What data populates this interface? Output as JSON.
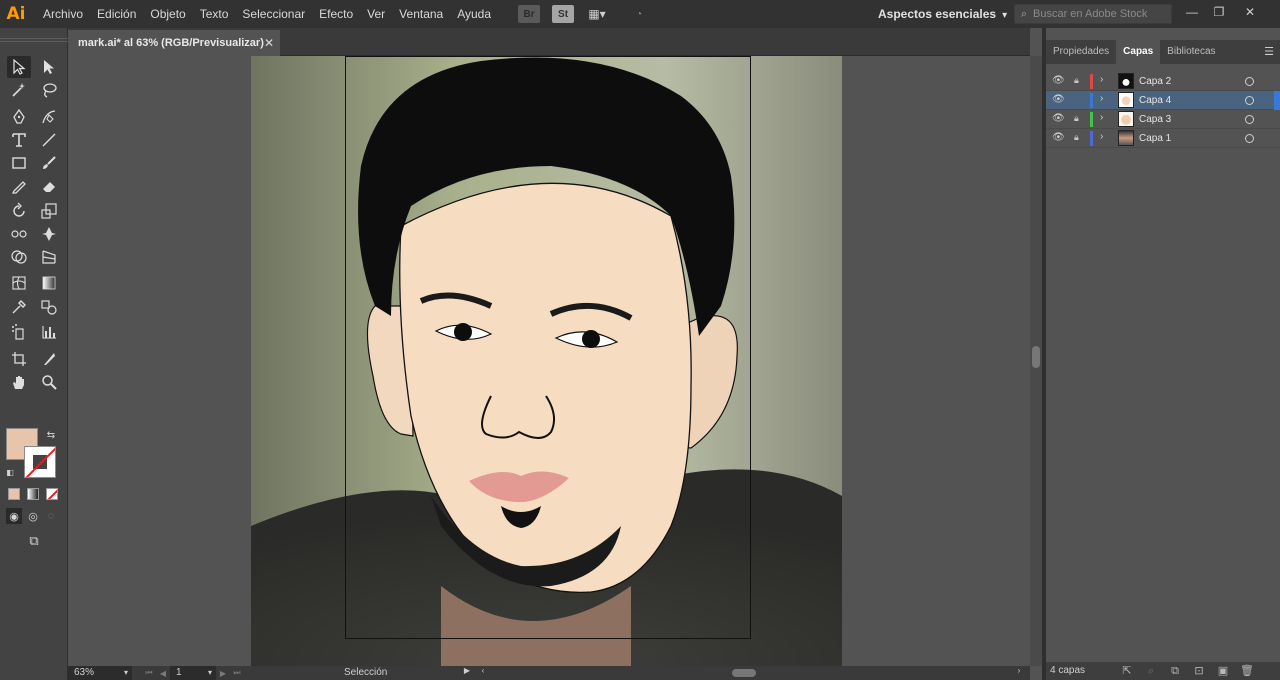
{
  "app": {
    "logo": "Ai"
  },
  "menu": [
    "Archivo",
    "Edición",
    "Objeto",
    "Texto",
    "Seleccionar",
    "Efecto",
    "Ver",
    "Ventana",
    "Ayuda"
  ],
  "top_icons": {
    "bridge": "Br",
    "stock": "St"
  },
  "workspace": {
    "label": "Aspectos esenciales"
  },
  "stock_search": {
    "placeholder": "Buscar en Adobe Stock"
  },
  "document": {
    "tab_title": "mark.ai* al 63% (RGB/Previsualizar)"
  },
  "status": {
    "zoom": "63%",
    "page": "1",
    "tool_label": "Selección"
  },
  "colors": {
    "fill": "#e7c4aa",
    "accent_selected_row": "#4a6480"
  },
  "panel": {
    "tabs": [
      "Propiedades",
      "Capas",
      "Bibliotecas"
    ],
    "active_tab": "Capas",
    "layers": [
      {
        "name": "Capa 2",
        "color": "#e04848",
        "locked": true,
        "selected": false
      },
      {
        "name": "Capa 4",
        "color": "#3a78d8",
        "locked": false,
        "selected": true
      },
      {
        "name": "Capa 3",
        "color": "#44c24a",
        "locked": true,
        "selected": false
      },
      {
        "name": "Capa 1",
        "color": "#4a6ad8",
        "locked": true,
        "selected": false
      }
    ],
    "layer_count": "4 capas"
  }
}
